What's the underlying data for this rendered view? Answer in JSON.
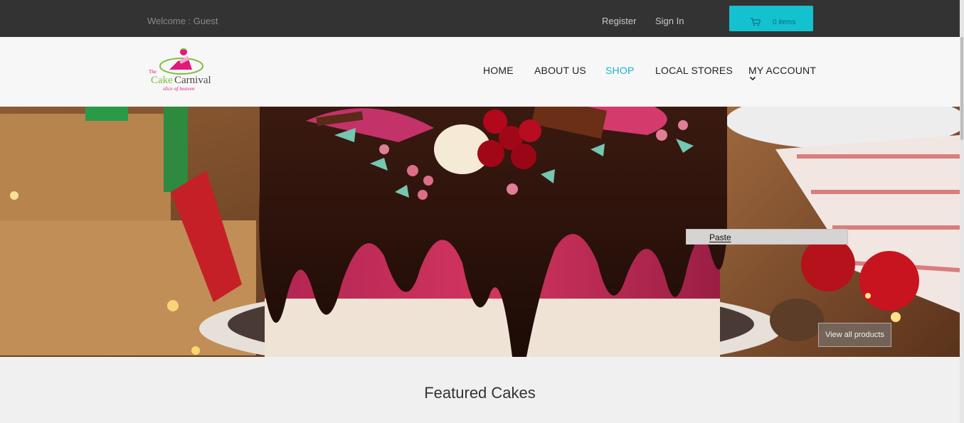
{
  "topbar": {
    "welcome": "Welcome : Guest",
    "register": "Register",
    "sign_in": "Sign In",
    "cart_count": "0 items",
    "cart_icon": "shopping-cart-icon",
    "accent": "#14c1cf"
  },
  "logo": {
    "the": "The",
    "cake": "Cake",
    "carnival": "Carnival",
    "tagline": "slice of heaven"
  },
  "nav": {
    "items": [
      {
        "label": "HOME"
      },
      {
        "label": "ABOUT US"
      },
      {
        "label": "SHOP"
      },
      {
        "label": "LOCAL STORES"
      },
      {
        "label": "MY ACCOUNT"
      }
    ],
    "active_color": "#14b7c6",
    "account_icon": "chevron-down-icon"
  },
  "hero": {
    "context_menu_item": "Paste",
    "view_all": "View all products"
  },
  "section": {
    "featured_title": "Featured Cakes"
  }
}
